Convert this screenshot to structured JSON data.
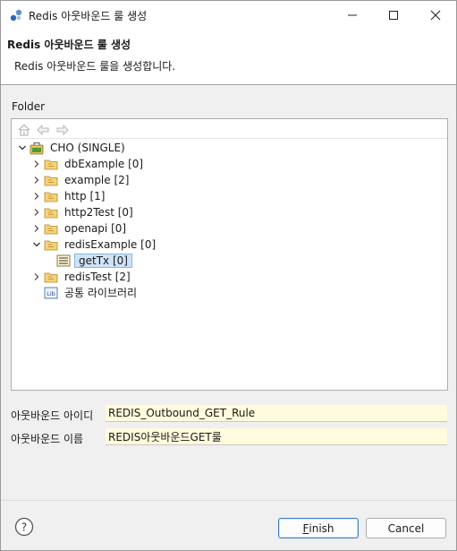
{
  "window": {
    "title": "Redis 아웃바운드 룰 생성",
    "buttons": [
      "minimize-button",
      "maximize-button",
      "close-button"
    ]
  },
  "banner": {
    "title": "Redis 아웃바운드 룰 생성",
    "description": "Redis 아웃바운드 룰을 생성합니다."
  },
  "folder_label": "Folder",
  "toolbar_icons": [
    "home-icon",
    "back-arrow-icon",
    "forward-arrow-icon"
  ],
  "tree": {
    "root": {
      "label": "CHO  (SINGLE)",
      "icon": "server-icon",
      "expanded": true
    },
    "items": [
      {
        "label": "dbExample [0]",
        "icon": "folder-icon",
        "expanded": false
      },
      {
        "label": "example [2]",
        "icon": "folder-icon",
        "expanded": false
      },
      {
        "label": "http [1]",
        "icon": "folder-icon",
        "expanded": false
      },
      {
        "label": "http2Test [0]",
        "icon": "folder-icon",
        "expanded": false
      },
      {
        "label": "openapi [0]",
        "icon": "folder-icon",
        "expanded": false
      },
      {
        "label": "redisExample [0]",
        "icon": "folder-icon",
        "expanded": true
      },
      {
        "label": "getTx [0]",
        "icon": "rule-icon",
        "selected": true
      },
      {
        "label": "redisTest [2]",
        "icon": "folder-icon",
        "expanded": false
      },
      {
        "label": "공통 라이브러리",
        "icon": "library-icon"
      }
    ]
  },
  "form": {
    "id_label": "아웃바운드 아이디",
    "id_value": "REDIS_Outbound_GET_Rule",
    "name_label": "아웃바운드 이름",
    "name_value": "REDIS아웃바운드GET룰"
  },
  "buttons": {
    "finish_mnemonic": "F",
    "finish_rest": "inish",
    "cancel": "Cancel"
  },
  "colors": {
    "input_background": "#fffbdc",
    "selection": "#cfe3f8",
    "folder": "#e8b84a",
    "default_button_border": "#3d7fc6"
  }
}
